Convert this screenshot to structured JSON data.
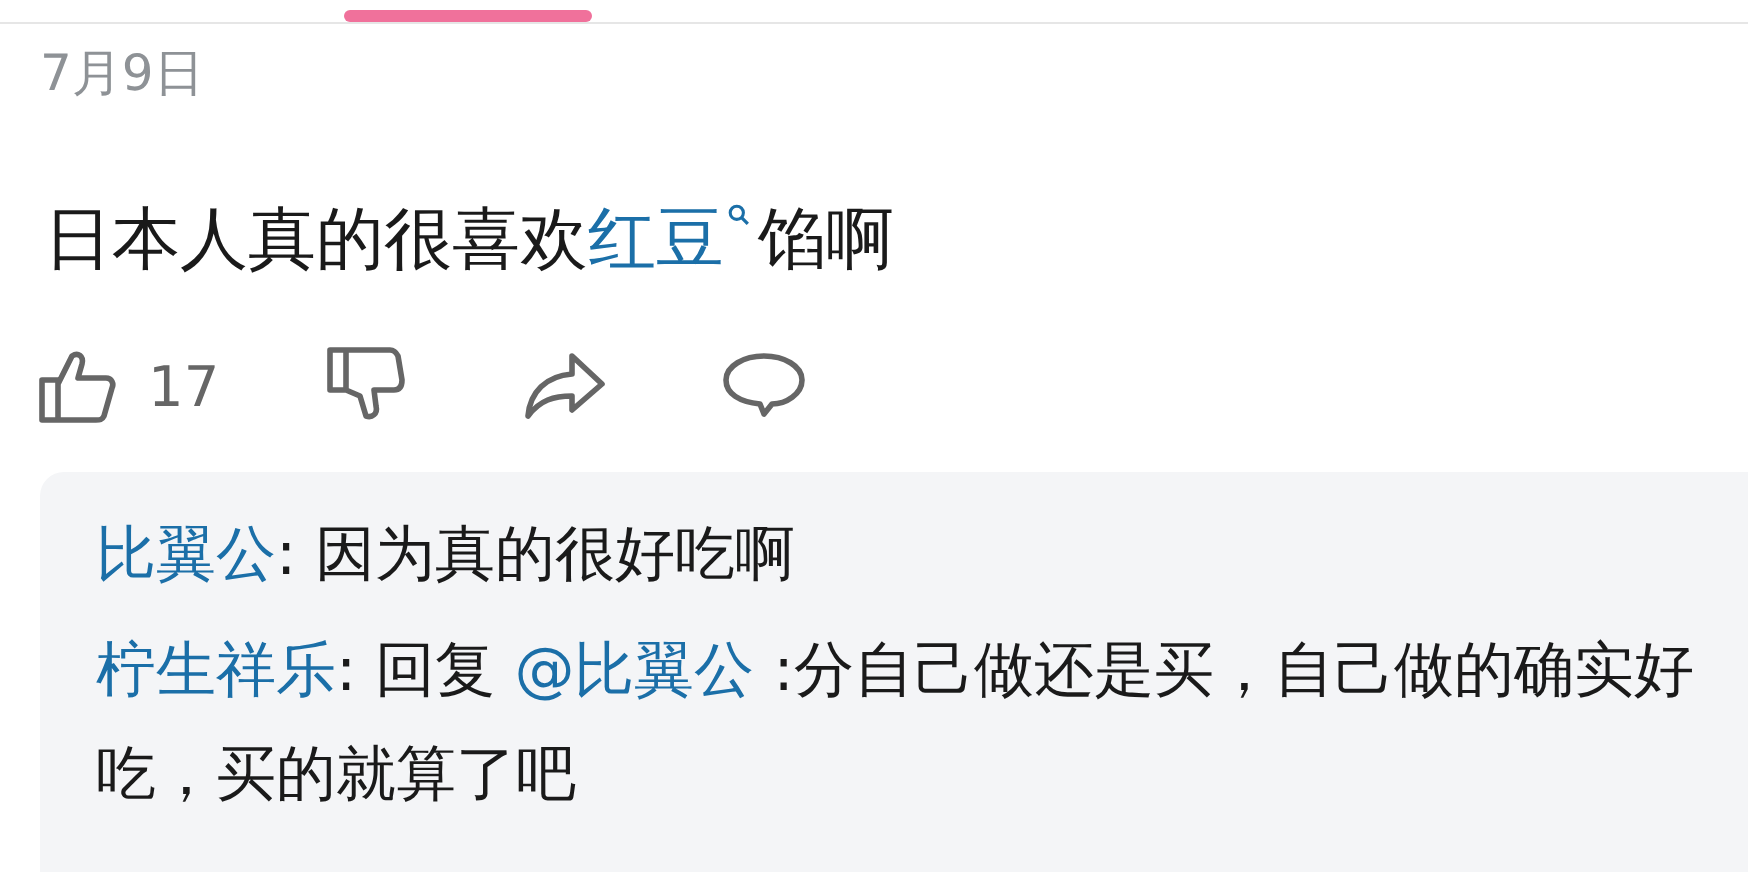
{
  "post": {
    "date": "7月9日",
    "text": {
      "before": "日本人真的很喜欢",
      "link": "红豆",
      "after": "馅啊"
    },
    "likes": "17"
  },
  "replies": [
    {
      "author": "比翼公",
      "separator": ":",
      "text": " 因为真的很好吃啊"
    },
    {
      "author": "柠生祥乐",
      "separator": ":",
      "prefix": " 回复 ",
      "mention": "@比翼公",
      "text": " :分自己做还是买，自己做的确实好吃，买的就算了吧"
    }
  ]
}
